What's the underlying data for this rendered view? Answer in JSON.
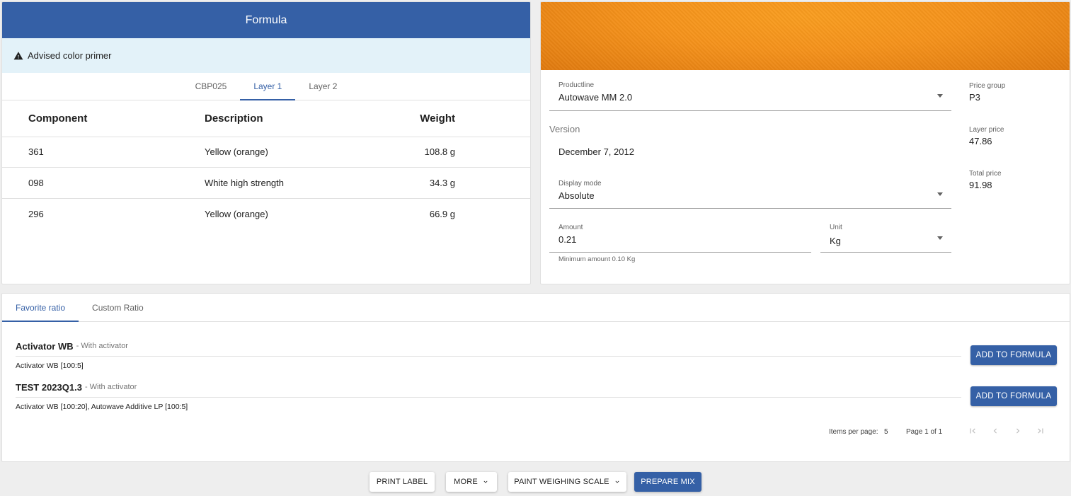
{
  "formula": {
    "title": "Formula",
    "advisory": "Advised color primer",
    "tabs": [
      {
        "label": "CBP025",
        "active": false
      },
      {
        "label": "Layer 1",
        "active": true
      },
      {
        "label": "Layer 2",
        "active": false
      }
    ],
    "columns": [
      "Component",
      "Description",
      "Weight"
    ],
    "rows": [
      {
        "component": "361",
        "description": "Yellow (orange)",
        "weight": "108.8 g"
      },
      {
        "component": "098",
        "description": "White high strength",
        "weight": "34.3 g"
      },
      {
        "component": "296",
        "description": "Yellow (orange)",
        "weight": "66.9 g"
      }
    ]
  },
  "color_swatch": {
    "color": "#f5921b"
  },
  "settings": {
    "productline": {
      "label": "Productline",
      "value": "Autowave MM 2.0"
    },
    "version": {
      "label": "Version",
      "value": "December 7, 2012"
    },
    "display_mode": {
      "label": "Display mode",
      "value": "Absolute"
    },
    "amount": {
      "label": "Amount",
      "value": "0.21",
      "hint": "Minimum amount 0.10 Kg"
    },
    "unit": {
      "label": "Unit",
      "value": "Kg"
    }
  },
  "prices": {
    "price_group": {
      "label": "Price group",
      "value": "P3"
    },
    "layer_price": {
      "label": "Layer price",
      "value": "47.86"
    },
    "total_price": {
      "label": "Total price",
      "value": "91.98"
    }
  },
  "ratio": {
    "tabs": [
      {
        "label": "Favorite ratio",
        "active": true
      },
      {
        "label": "Custom Ratio",
        "active": false
      }
    ],
    "items": [
      {
        "name": "Activator WB",
        "suffix": "- With activator",
        "description": "Activator WB [100:5]",
        "button": "ADD TO FORMULA"
      },
      {
        "name": "TEST 2023Q1.3",
        "suffix": "- With activator",
        "description": "Activator WB [100:20], Autowave Additive LP [100:5]",
        "button": "ADD TO FORMULA"
      }
    ],
    "pager": {
      "items_per_page_label": "Items per page:",
      "items_per_page": "5",
      "range": "Page 1 of 1"
    }
  },
  "actions": {
    "print_label": "PRINT LABEL",
    "more": "MORE",
    "paint_weighing_scale": "PAINT WEIGHING SCALE",
    "prepare_mix": "PREPARE MIX"
  },
  "colors": {
    "primary": "#3560a6",
    "advisory_bg": "#e3f2f9"
  }
}
